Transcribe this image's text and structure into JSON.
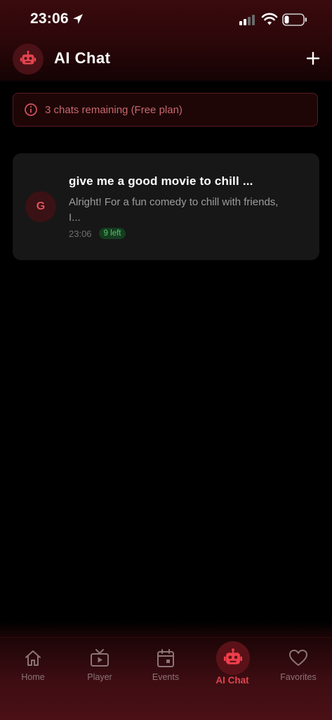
{
  "status_bar": {
    "time": "23:06",
    "icons": [
      "location-arrow-icon",
      "signal-icon",
      "wifi-icon",
      "battery-icon"
    ]
  },
  "header": {
    "title": "AI Chat",
    "avatar_icon": "robot-icon",
    "add_icon": "plus-icon"
  },
  "plan_banner": {
    "text": "3 chats remaining (Free plan)",
    "icon": "info-icon"
  },
  "chats": [
    {
      "avatar_letter": "G",
      "title": "give me a good movie to chill ...",
      "preview": "Alright! For a fun comedy to chill with friends, I...",
      "time": "23:06",
      "badge": "9 left"
    }
  ],
  "nav": {
    "items": [
      {
        "label": "Home",
        "icon": "home-icon"
      },
      {
        "label": "Player",
        "icon": "tv-icon"
      },
      {
        "label": "Events",
        "icon": "calendar-icon"
      },
      {
        "label": "AI Chat",
        "icon": "robot-icon",
        "active": true
      },
      {
        "label": "Favorites",
        "icon": "heart-icon"
      }
    ]
  },
  "colors": {
    "accent": "#e0434d",
    "badge_green": "#57c26a",
    "card_bg": "#171717"
  }
}
